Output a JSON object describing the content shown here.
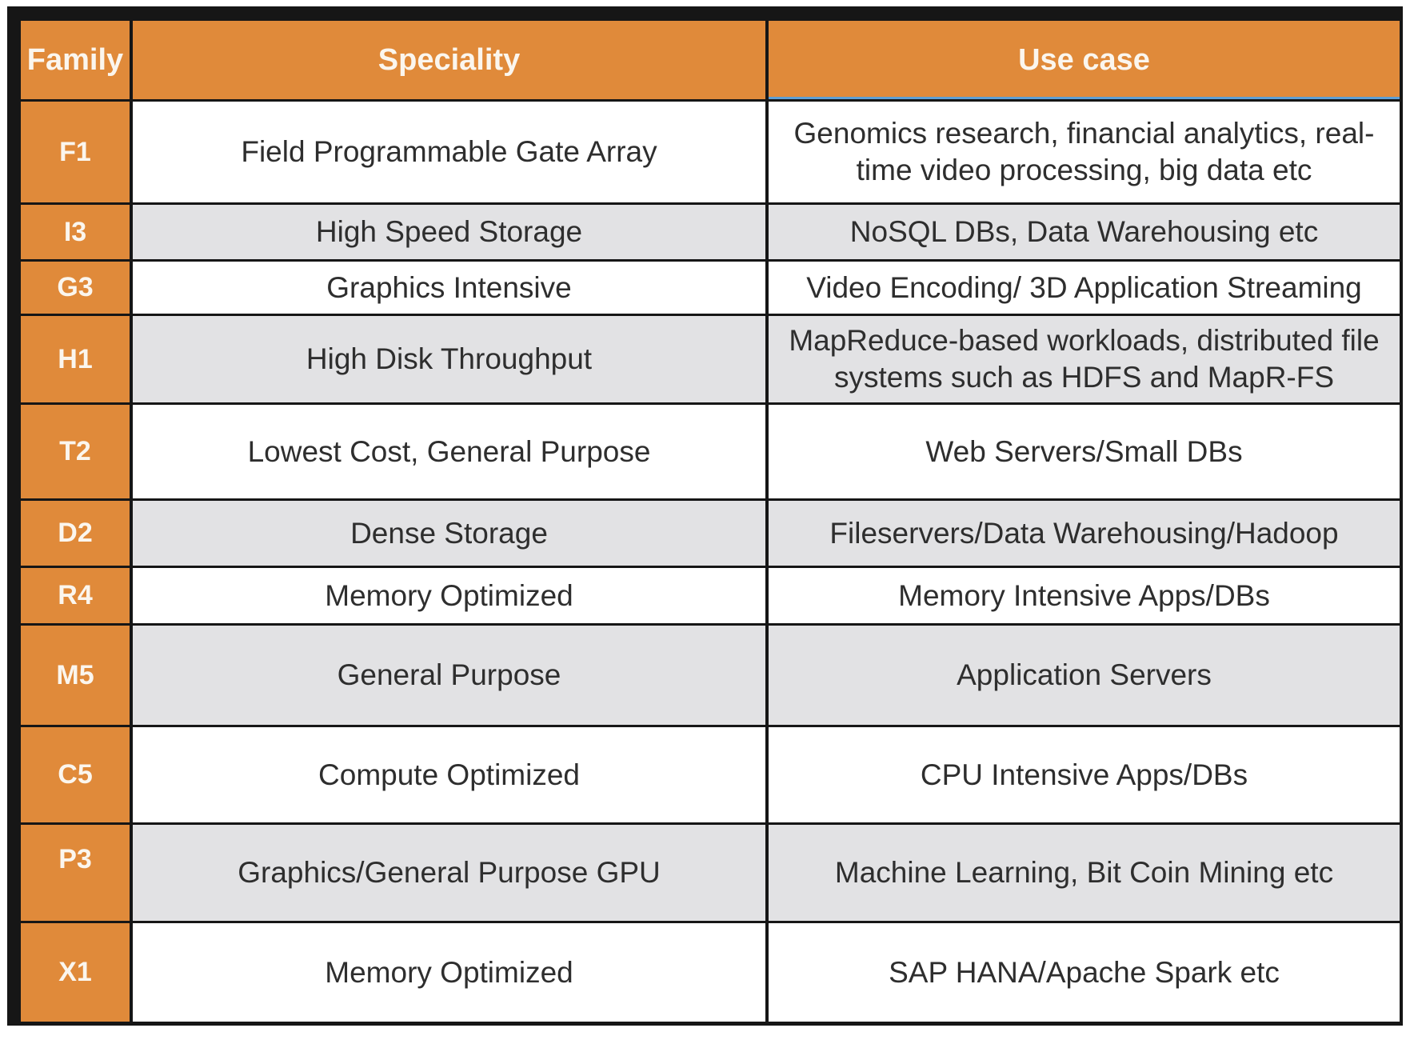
{
  "table": {
    "headers": [
      "Family",
      "Speciality",
      "Use case"
    ],
    "rows": [
      {
        "family": "F1",
        "speciality": "Field Programmable Gate Array",
        "use_case": "Genomics research, financial analytics, real-time video processing, big data etc"
      },
      {
        "family": "I3",
        "speciality": "High Speed Storage",
        "use_case": "NoSQL DBs, Data Warehousing etc"
      },
      {
        "family": "G3",
        "speciality": "Graphics Intensive",
        "use_case": "Video Encoding/ 3D Application Streaming"
      },
      {
        "family": "H1",
        "speciality": "High Disk Throughput",
        "use_case": "MapReduce-based workloads, distributed file systems such as HDFS and MapR-FS"
      },
      {
        "family": "T2",
        "speciality": "Lowest Cost, General Purpose",
        "use_case": "Web Servers/Small DBs"
      },
      {
        "family": "D2",
        "speciality": "Dense Storage",
        "use_case": "Fileservers/Data Warehousing/Hadoop"
      },
      {
        "family": "R4",
        "speciality": "Memory Optimized",
        "use_case": "Memory Intensive Apps/DBs"
      },
      {
        "family": "M5",
        "speciality": "General Purpose",
        "use_case": "Application Servers"
      },
      {
        "family": "C5",
        "speciality": "Compute Optimized",
        "use_case": "CPU Intensive Apps/DBs"
      },
      {
        "family": "P3",
        "speciality": "Graphics/General Purpose GPU",
        "use_case": "Machine Learning, Bit Coin Mining etc"
      },
      {
        "family": "X1",
        "speciality": "Memory Optimized",
        "use_case": "SAP HANA/Apache Spark etc"
      }
    ]
  },
  "colors": {
    "header_bg": "#e08a3a",
    "header_text": "#fbf6ee",
    "row_light": "#ffffff",
    "row_shaded": "#e2e2e4",
    "grid": "#161616"
  }
}
